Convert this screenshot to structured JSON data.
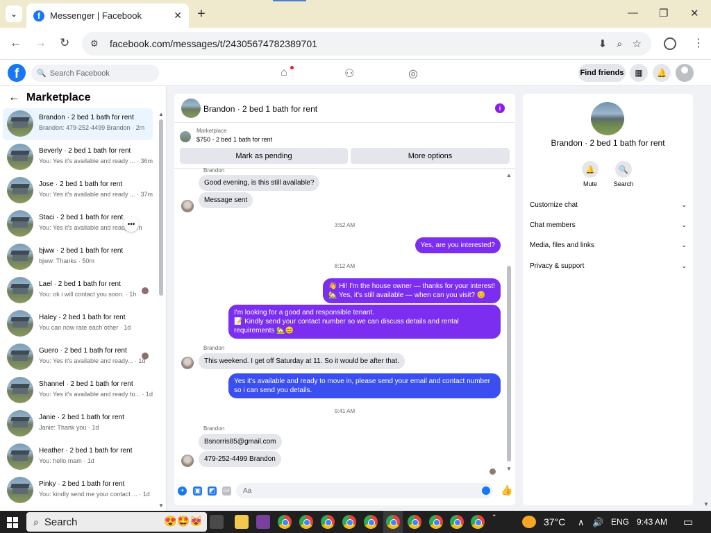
{
  "browser": {
    "tab_title": "Messenger | Facebook",
    "url": "facebook.com/messages/t/24305674782389701"
  },
  "fb_header": {
    "search_placeholder": "Search Facebook",
    "find_friends": "Find friends"
  },
  "left_panel": {
    "title": "Marketplace",
    "conversations": [
      {
        "name": "Brandon · 2 bed 1 bath for rent",
        "preview": "Brandon: 479-252-4499 Brandon · 2m",
        "active": true
      },
      {
        "name": "Beverly · 2 bed 1 bath for rent",
        "preview": "You: Yes it's available and ready ... · 36m"
      },
      {
        "name": "Jose · 2 bed 1 bath for rent",
        "preview": "You: Yes it's available and ready ... · 37m"
      },
      {
        "name": "Staci · 2 bed 1 bath for rent",
        "preview": "You: Yes it's available and ready ... m"
      },
      {
        "name": "bjww · 2 bed 1 bath for rent",
        "preview": "bjww: Thanks · 50m"
      },
      {
        "name": "Lael · 2 bed 1 bath for rent",
        "preview": "You: ok i will contact you soon. · 1h"
      },
      {
        "name": "Haley · 2 bed 1 bath for rent",
        "preview": "You can now rate each other · 1d"
      },
      {
        "name": "Guero · 2 bed 1 bath for rent",
        "preview": "You: Yes it's available and ready... · 1d"
      },
      {
        "name": "Shannel · 2 bed 1 bath for rent",
        "preview": "You: Yes it's available and ready to... · 1d"
      },
      {
        "name": "Janie · 2 bed 1 bath for rent",
        "preview": "Janie: Thank you · 1d"
      },
      {
        "name": "Heather · 2 bed 1 bath for rent",
        "preview": "You: hello mam · 1d"
      },
      {
        "name": "Pinky · 2 bed 1 bath for rent",
        "preview": "You: kindly send me your contact ... · 1d"
      }
    ]
  },
  "chat": {
    "title": "Brandon · 2 bed 1 bath for rent",
    "marketplace_label": "Marketplace",
    "listing": "$750 - 2 bed 1 bath for rent",
    "mark_pending": "Mark as pending",
    "more_options": "More options",
    "messages": {
      "sender_top": "Brandon",
      "m1": "Good evening, is this still available?",
      "m2": "Message sent",
      "ts1": "3:52 AM",
      "m3": "Yes, are you interested?",
      "ts2": "8:12 AM",
      "m4_l1": "👋 Hi! I'm the house owner — thanks for your interest!",
      "m4_l2": "🏡 Yes, it's still available — when can you visit? 😊",
      "m5_l1": "I'm looking for a good and responsible tenant.",
      "m5_l2": "📝 Kindly send your contact number so we can discuss details and rental",
      "m5_l3": "requirements 🏡😊",
      "sender2": "Brandon",
      "m6": "This weekend. I get off Saturday at 11. So it would be after that.",
      "m7_l1": "Yes it's available and ready to move in, please send your email and contact number",
      "m7_l2": "so i can send you details.",
      "ts3": "9:41 AM",
      "sender3": "Brandon",
      "m8": "Bsnorris85@gmail.com",
      "m9": "479-252-4499 Brandon"
    },
    "composer_placeholder": "Aa"
  },
  "right_panel": {
    "name": "Brandon · 2 bed 1 bath for rent",
    "mute": "Mute",
    "search": "Search",
    "sections": [
      "Customize chat",
      "Chat members",
      "Media, files and links",
      "Privacy & support"
    ]
  },
  "taskbar": {
    "search": "Search",
    "temp": "37°C",
    "lang": "ENG",
    "time": "9:43 AM"
  },
  "colors": {
    "fb_blue": "#1877f2",
    "outgoing_purple": "#7b2df0",
    "outgoing_blue": "#3b4ff0"
  }
}
